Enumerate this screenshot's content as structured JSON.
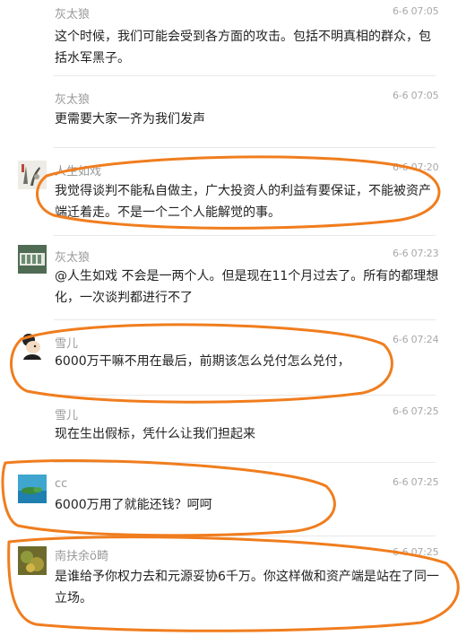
{
  "comments": [
    {
      "user": "灰太狼",
      "time": "6-6 07:05",
      "text": "这个时候，我们可能会受到各方面的攻击。包括不明真相的群众，包括水军黑子。",
      "avatar": "none"
    },
    {
      "user": "灰太狼",
      "time": "6-6 07:05",
      "text": "更需要大家一齐为我们发声",
      "avatar": "none"
    },
    {
      "user": "人生如戏",
      "time": "6-6 07:20",
      "text": "我觉得谈判不能私自做主，广大投资人的利益有要保证，不能被资产端迁着走。不是一个二个人能解觉的事。",
      "avatar": "ink-painting-avatar"
    },
    {
      "user": "灰太狼",
      "time": "6-6 07:23",
      "text": "@人生如戏 不会是一两个人。但是现在11个月过去了。所有的都理想化，一次谈判都进行不了",
      "avatar": "banner-avatar"
    },
    {
      "user": "雪儿",
      "time": "6-6 07:24",
      "text": "6000万干嘛不用在最后，前期该怎么兑付怎么兑付，",
      "avatar": "cartoon-avatar"
    },
    {
      "user": "雪儿",
      "time": "6-6 07:25",
      "text": "现在生出假标，凭什么让我们担起来",
      "avatar": "none"
    },
    {
      "user": "cc",
      "time": "6-6 07:25",
      "text": "6000万用了就能还钱？呵呵",
      "avatar": "island-avatar"
    },
    {
      "user": "南扶余ö畸",
      "time": "6-6 07:25",
      "text": "是谁给予你权力去和元源妥协6千万。你这样做和资产端是站在了同一立场。",
      "avatar": "plant-avatar"
    }
  ],
  "annotation_color": "#f07d1e"
}
